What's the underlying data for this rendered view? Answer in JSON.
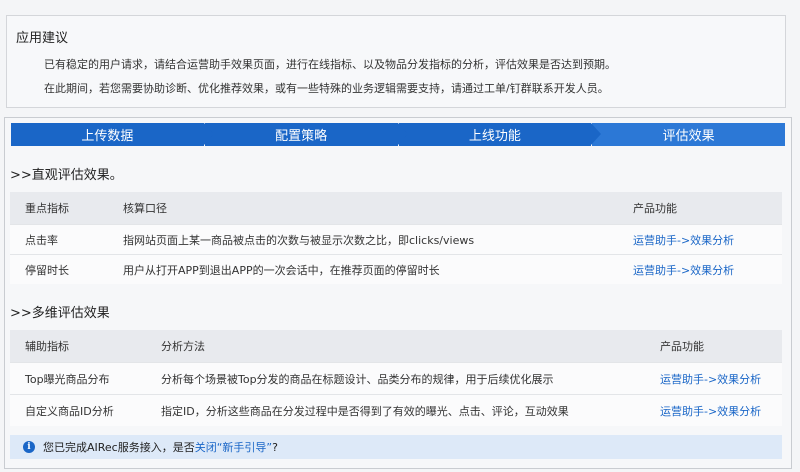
{
  "advice": {
    "title": "应用建议",
    "line1": "已有稳定的用户请求，请结合运营助手效果页面，进行在线指标、以及物品分发指标的分析，评估效果是否达到预期。",
    "line2": "在此期间，若您需要协助诊断、优化推荐效果，或有一些特殊的业务逻辑需要支持，请通过工单/钉群联系开发人员。"
  },
  "steps": [
    {
      "label": "上传数据"
    },
    {
      "label": "配置策略"
    },
    {
      "label": "上线功能"
    },
    {
      "label": "评估效果"
    }
  ],
  "section1": {
    "title": ">>直观评估效果。",
    "headers": [
      "重点指标",
      "核算口径",
      "产品功能"
    ],
    "rows": [
      {
        "metric": "点击率",
        "desc": "指网站页面上某一商品被点击的次数与被显示次数之比，即clicks/views",
        "link": "运营助手->效果分析"
      },
      {
        "metric": "停留时长",
        "desc": "用户从打开APP到退出APP的一次会话中，在推荐页面的停留时长",
        "link": "运营助手->效果分析"
      }
    ]
  },
  "section2": {
    "title": ">>多维评估效果",
    "headers": [
      "辅助指标",
      "分析方法",
      "产品功能"
    ],
    "rows": [
      {
        "metric": "Top曝光商品分布",
        "desc": "分析每个场景被Top分发的商品在标题设计、品类分布的规律，用于后续优化展示",
        "link": "运营助手->效果分析"
      },
      {
        "metric": "自定义商品ID分析",
        "desc": "指定ID，分析这些商品在分发过程中是否得到了有效的曝光、点击、评论，互动效果",
        "link": "运营助手->效果分析"
      }
    ]
  },
  "notice": {
    "text_before": "您已完成AIRec服务接入，是否",
    "link": "关闭“新手引导”",
    "text_after": "?"
  }
}
